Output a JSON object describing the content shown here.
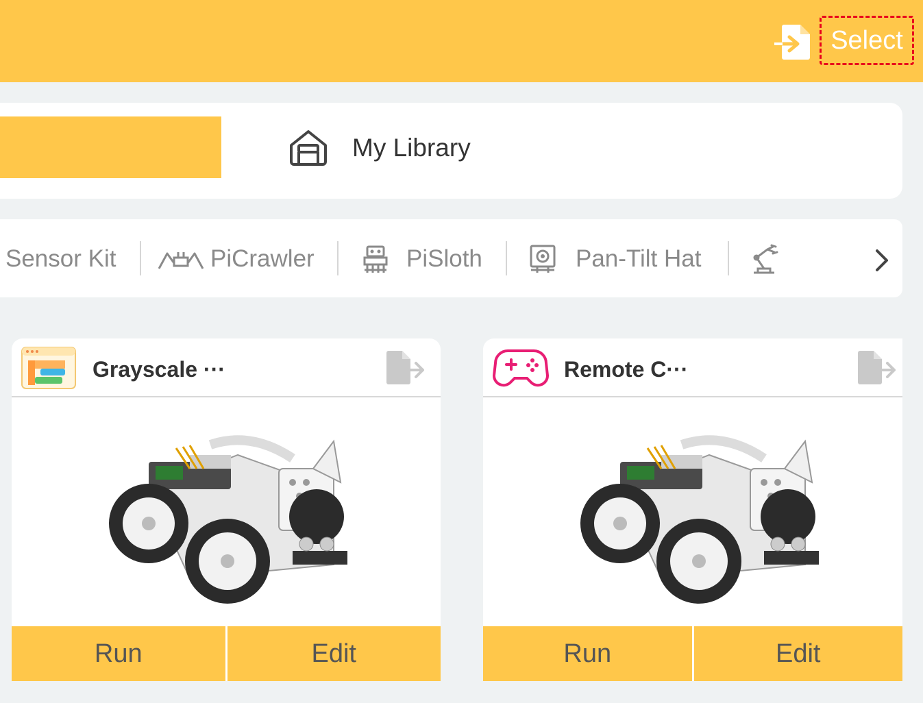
{
  "header": {
    "select_label": "Select",
    "import_icon": "import-file-icon",
    "bg_color": "#ffc74a",
    "highlight_color": "#e8001c"
  },
  "library": {
    "label": "My Library",
    "icon": "home-box-icon"
  },
  "kits": [
    {
      "label": "Sensor Kit",
      "icon": ""
    },
    {
      "label": "PiCrawler",
      "icon": "crawler-icon"
    },
    {
      "label": "PiSloth",
      "icon": "robot-icon"
    },
    {
      "label": "Pan-Tilt Hat",
      "icon": "camera-mount-icon"
    },
    {
      "label": "",
      "icon": "robot-arm-icon"
    }
  ],
  "cards": [
    {
      "title": "Grayscale",
      "ellipsis": "···",
      "icon": "blocks-app-icon",
      "run_label": "Run",
      "edit_label": "Edit"
    },
    {
      "title": "Remote C",
      "ellipsis": "···",
      "icon": "gamepad-icon",
      "run_label": "Run",
      "edit_label": "Edit"
    }
  ]
}
